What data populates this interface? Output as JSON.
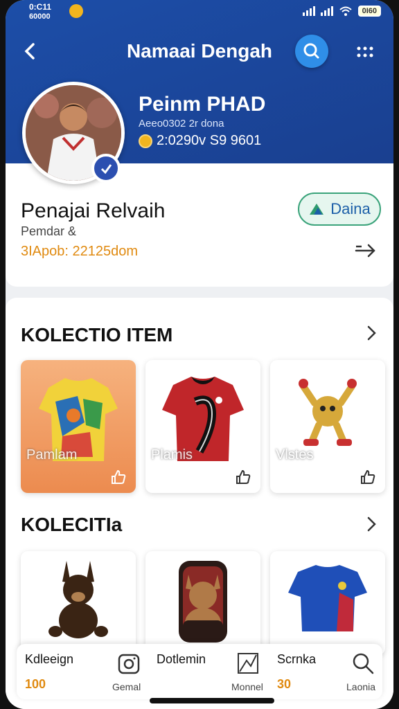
{
  "status": {
    "time": "0:C11",
    "time2": "60000",
    "battery": "0I60"
  },
  "header": {
    "title": "Namaai Dengah"
  },
  "profile": {
    "hero_name": "Peinm PHAD",
    "hero_sub": "Aeeo0302 2r dona",
    "hero_coins": "2:0290v S9 9601",
    "name": "Penajai Relvaih",
    "role": "Pemdar &",
    "count": "3IApob: 22125dom",
    "follow_label": "Daina"
  },
  "section1": {
    "title": "KOLECTIO ITEM",
    "items": [
      {
        "label": "Pamlam",
        "icon": "jersey-icon"
      },
      {
        "label": "Plamis",
        "icon": "jersey-icon"
      },
      {
        "label": "Vlstes",
        "icon": "mascot-icon"
      }
    ]
  },
  "section2": {
    "title": "KOLECITIa",
    "items": [
      {
        "icon": "plush-dog-icon"
      },
      {
        "icon": "plush-bag-icon"
      },
      {
        "icon": "jersey-icon"
      }
    ]
  },
  "bottom_nav": {
    "stat1_label": "Kdleeign",
    "stat1_value": "100",
    "tab1_label": "Gemal",
    "stat2_label": "Dotlemin",
    "tab2_label": "Monnel",
    "stat3_label": "Scrnka",
    "stat3_value": "30",
    "tab3_label": "Laonia"
  },
  "colors": {
    "hero": "#1c4ea8",
    "accent": "#e08a10",
    "follow_border": "#3aa37a"
  }
}
